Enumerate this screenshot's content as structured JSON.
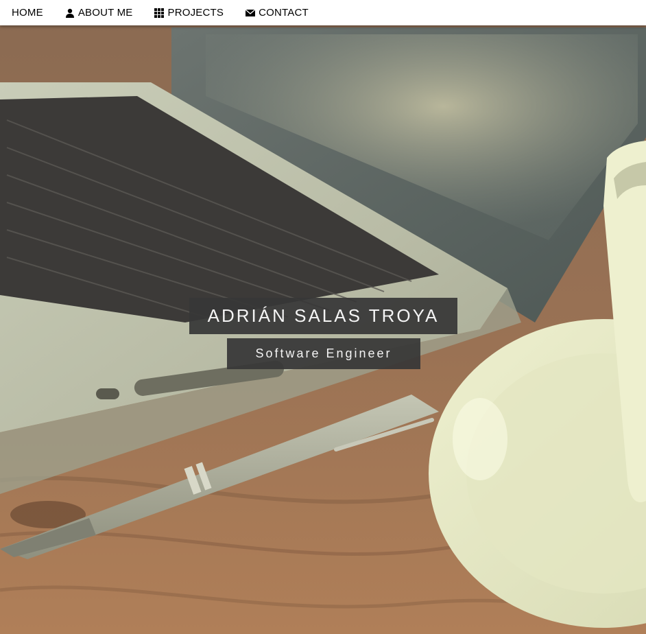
{
  "nav": {
    "items": [
      {
        "label": "HOME",
        "icon": ""
      },
      {
        "label": "ABOUT ME",
        "icon": "user-icon"
      },
      {
        "label": "PROJECTS",
        "icon": "grid-icon"
      },
      {
        "label": "CONTACT",
        "icon": "envelope-icon"
      }
    ]
  },
  "hero": {
    "name": "ADRIÁN SALAS TROYA",
    "role": "Software Engineer"
  },
  "colors": {
    "nav_background": "#ffffff",
    "title_box": "#373737",
    "title_text": "#f4f4f4"
  }
}
